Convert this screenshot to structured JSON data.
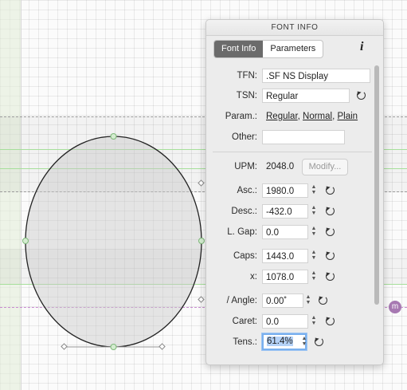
{
  "panel": {
    "title": "FONT INFO",
    "tabs": [
      "Font Info",
      "Parameters"
    ],
    "active_tab": "Font Info",
    "info_icon": "i",
    "fields": {
      "tfn": {
        "label": "TFN:",
        "value": ".SF NS Display"
      },
      "tsn": {
        "label": "TSN:",
        "value": "Regular"
      },
      "param": {
        "label": "Param.:",
        "values": [
          "Regular",
          "Normal",
          "Plain"
        ]
      },
      "other": {
        "label": "Other:",
        "value": ""
      },
      "upm": {
        "label": "UPM:",
        "value": "2048.0",
        "button": "Modify..."
      },
      "asc": {
        "label": "Asc.:",
        "value": "1980.0"
      },
      "desc": {
        "label": "Desc.:",
        "value": "-432.0"
      },
      "lgap": {
        "label": "L. Gap:",
        "value": "0.0"
      },
      "caps": {
        "label": "Caps:",
        "value": "1443.0"
      },
      "x": {
        "label": "x:",
        "value": "1078.0"
      },
      "angle": {
        "label": "/ Angle:",
        "value": "0.00˚"
      },
      "caret": {
        "label": "Caret:",
        "value": "0.0"
      },
      "tens": {
        "label": "Tens.:",
        "value": "61.4%"
      }
    }
  },
  "badge": {
    "label": "m"
  },
  "colors": {
    "accent_focus": "#7ab0ee",
    "guide_green": "#a6df9a",
    "guide_purple": "#c88bd0",
    "node_green": "#7fb97a",
    "badge": "#a779b2"
  },
  "icons": [
    "info-icon",
    "reset-icon",
    "stepper-icon"
  ]
}
